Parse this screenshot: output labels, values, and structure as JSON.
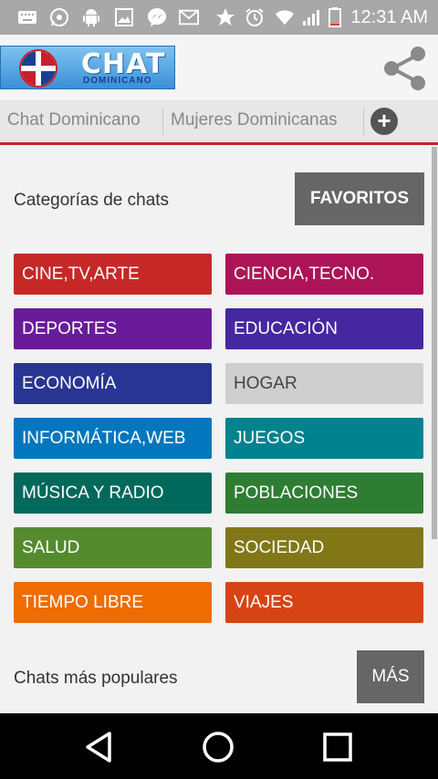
{
  "status_bar": {
    "time": "12:31 AM",
    "icons": [
      "keyboard-icon",
      "whatsapp-icon",
      "android-icon",
      "image-icon",
      "messenger-icon",
      "mail-icon",
      "star-icon",
      "alarm-icon",
      "wifi-icon",
      "signal-icon",
      "battery-icon"
    ]
  },
  "app_bar": {
    "logo_title": "CHAT",
    "logo_subtitle": "DOMINICANO"
  },
  "tabs": [
    {
      "label": "Chat Dominicano"
    },
    {
      "label": "Mujeres Dominicanas"
    }
  ],
  "categories_section": {
    "title": "Categorías de chats",
    "favorites_label": "FAVORITOS"
  },
  "categories": [
    {
      "label": "CINE,TV,ARTE",
      "color": "#c62828"
    },
    {
      "label": "CIENCIA,TECNO.",
      "color": "#ad1457"
    },
    {
      "label": "DEPORTES",
      "color": "#6a1b9a"
    },
    {
      "label": "EDUCACIÓN",
      "color": "#4527a0"
    },
    {
      "label": "ECONOMÍA",
      "color": "#283593"
    },
    {
      "label": "HOGAR",
      "color": "#cfcfcf",
      "text_color": "#444444"
    },
    {
      "label": "INFORMÁTICA,WEB",
      "color": "#0277bd"
    },
    {
      "label": "JUEGOS",
      "color": "#00838f"
    },
    {
      "label": "MÚSICA Y RADIO",
      "color": "#00695c"
    },
    {
      "label": "POBLACIONES",
      "color": "#2e7d32"
    },
    {
      "label": "SALUD",
      "color": "#558b2f"
    },
    {
      "label": "SOCIEDAD",
      "color": "#827717"
    },
    {
      "label": "TIEMPO LIBRE",
      "color": "#ef6c00"
    },
    {
      "label": "VIAJES",
      "color": "#d84315"
    }
  ],
  "popular_section": {
    "title": "Chats más populares",
    "more_label": "MÁS"
  },
  "accent_color": "#c8232b"
}
